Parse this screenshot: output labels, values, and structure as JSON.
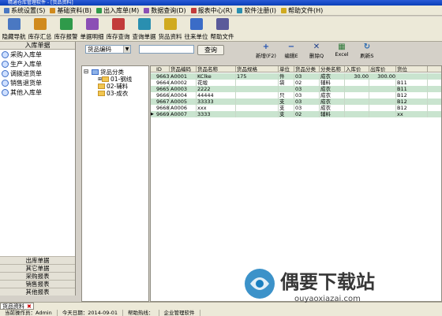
{
  "window": {
    "title": "精通仓库管理软件 - [货品资料]"
  },
  "colors": {
    "titlebar": "#0a3fb8",
    "row_alt": "#c9e4cf",
    "accent_red": "#c00000"
  },
  "menu": [
    {
      "label": "系统设置(S)",
      "icon": "gear-icon"
    },
    {
      "label": "基础资料(B)",
      "icon": "folder-icon"
    },
    {
      "label": "出入库单(M)",
      "icon": "doc-icon"
    },
    {
      "label": "数据查询(D)",
      "icon": "search-icon"
    },
    {
      "label": "报表中心(R)",
      "icon": "chart-icon"
    },
    {
      "label": "软件注册(I)",
      "icon": "key-icon"
    },
    {
      "label": "帮助文件(H)",
      "icon": "help-icon"
    }
  ],
  "toolbar": [
    {
      "label": "隐藏导航",
      "icon": "hide-nav-icon"
    },
    {
      "label": "库存汇总",
      "icon": "summary-icon"
    },
    {
      "label": "库存报警",
      "icon": "alarm-icon"
    },
    {
      "label": "单据明细",
      "icon": "detail-icon"
    },
    {
      "label": "库存查询",
      "icon": "stock-query-icon"
    },
    {
      "label": "查询单据",
      "icon": "doc-query-icon"
    },
    {
      "label": "货品资料",
      "icon": "goods-icon"
    },
    {
      "label": "往来单位",
      "icon": "partner-icon"
    },
    {
      "label": "帮助文件",
      "icon": "help-icon"
    }
  ],
  "left_panel": {
    "header": "入库单据",
    "items": [
      "采购入库单",
      "生产入库单",
      "调拨进货单",
      "销售退货单",
      "其他入库单"
    ],
    "footer": [
      "出库单据",
      "其它单据",
      "采购报表",
      "销售报表",
      "其他报表"
    ]
  },
  "search": {
    "field_value": "货品编码",
    "input_value": "",
    "button_label": "查询"
  },
  "actions": [
    {
      "label": "新增(F2)",
      "icon": "plus-icon"
    },
    {
      "label": "编辑E",
      "icon": "minus-icon"
    },
    {
      "label": "删除Q",
      "icon": "delete-icon"
    },
    {
      "label": "Excel",
      "icon": "excel-icon"
    },
    {
      "label": "刷新S",
      "icon": "refresh-icon"
    }
  ],
  "tree": {
    "root": "货品分类",
    "children": [
      "01-钢线",
      "02-辅料",
      "03-成衣"
    ]
  },
  "grid": {
    "columns": [
      "ID",
      "货品编码",
      "货品名称",
      "货品规格",
      "单位",
      "货品分类",
      "分类名称",
      "入库价",
      "出库价",
      "货位"
    ],
    "rows": [
      [
        "9663",
        "A0001",
        "KClke",
        "175",
        "件",
        "03",
        "成衣",
        "30.00",
        "300.00",
        ""
      ],
      [
        "9664",
        "A0002",
        "花缎",
        "",
        "袋",
        "02",
        "辅料",
        "",
        "",
        "B11"
      ],
      [
        "9665",
        "A0003",
        "2222",
        "",
        "",
        "03",
        "成衣",
        "",
        "",
        "B11"
      ],
      [
        "9666",
        "A0004",
        "44444",
        "",
        "只",
        "03",
        "成衣",
        "",
        "",
        "B12"
      ],
      [
        "9667",
        "A0005",
        "33333",
        "",
        "支",
        "03",
        "成衣",
        "",
        "",
        "B12"
      ],
      [
        "9668",
        "A0006",
        "xxx",
        "",
        "支",
        "03",
        "成衣",
        "",
        "",
        "B12"
      ],
      [
        "9669",
        "A0007",
        "3333",
        "",
        "支",
        "02",
        "辅料",
        "",
        "",
        "xx"
      ]
    ]
  },
  "bottom_tab": {
    "label": "货品资料"
  },
  "status": [
    "当前操作员：Admin",
    "今天日期：2014-09-01",
    "帮助热线：",
    "企业管理软件"
  ],
  "watermark": {
    "brand": "偶要下载站",
    "url": "ouyaoxiazai.com"
  }
}
